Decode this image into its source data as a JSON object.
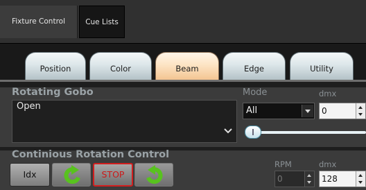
{
  "top_tabs": [
    "Fixture Control",
    "Cue Lists"
  ],
  "sub_tabs": [
    "Position",
    "Color",
    "Beam",
    "Edge",
    "Utility"
  ],
  "active_sub_tab": "Beam",
  "gobo": {
    "title": "Rotating Gobo",
    "value": "Open",
    "mode_label": "Mode",
    "mode_value": "All",
    "dmx_label": "dmx",
    "dmx_value": "0",
    "slider_value_fraction": 0.0
  },
  "rotation": {
    "title": "Continious Rotation Control",
    "idx_label": "Idx",
    "stop_label": "STOP",
    "rpm_label": "RPM",
    "rpm_value": "0",
    "dmx_label": "dmx",
    "dmx_value": "128"
  },
  "colors": {
    "accent_green": "#58c21e",
    "stop_red": "#d21e1e",
    "active_tab": "#fde4c4"
  },
  "icons": [
    "rotate-ccw-icon",
    "rotate-cw-icon",
    "chevron-down-icon"
  ]
}
